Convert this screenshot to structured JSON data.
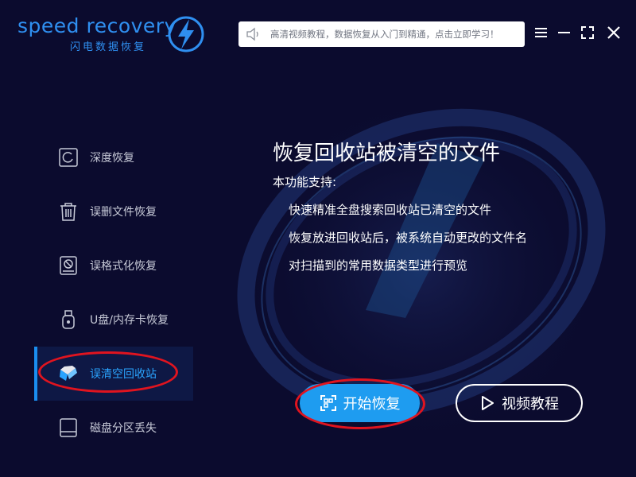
{
  "app": {
    "logo_text": "speed recovery",
    "logo_subtitle": "闪电数据恢复"
  },
  "notice": {
    "text": "高清视频教程，数据恢复从入门到精通，点击立即学习！",
    "icon": "speaker-icon"
  },
  "window_controls": {
    "menu": "menu-icon",
    "minimize": "minimize-icon",
    "maximize": "maximize-icon",
    "close": "close-icon"
  },
  "sidebar": {
    "items": [
      {
        "label": "深度恢复",
        "icon": "deep-recovery-icon"
      },
      {
        "label": "误删文件恢复",
        "icon": "trash-icon"
      },
      {
        "label": "误格式化恢复",
        "icon": "format-disk-icon"
      },
      {
        "label": "U盘/内存卡恢复",
        "icon": "usb-icon"
      },
      {
        "label": "误清空回收站",
        "icon": "recycle-bin-icon",
        "active": true
      },
      {
        "label": "磁盘分区丢失",
        "icon": "disk-partition-icon"
      }
    ]
  },
  "main": {
    "title": "恢复回收站被清空的文件",
    "subtitle": "本功能支持:",
    "features": [
      "快速精准全盘搜索回收站已清空的文件",
      "恢复放进回收站后，被系统自动更改的文件名",
      "对扫描到的常用数据类型进行预览"
    ],
    "start_button": "开始恢复",
    "video_button": "视频教程"
  },
  "colors": {
    "background": "#0b0b2e",
    "accent": "#1e9cf0",
    "highlight": "#e0141f",
    "sidebar_active_bg": "#0e1845"
  }
}
